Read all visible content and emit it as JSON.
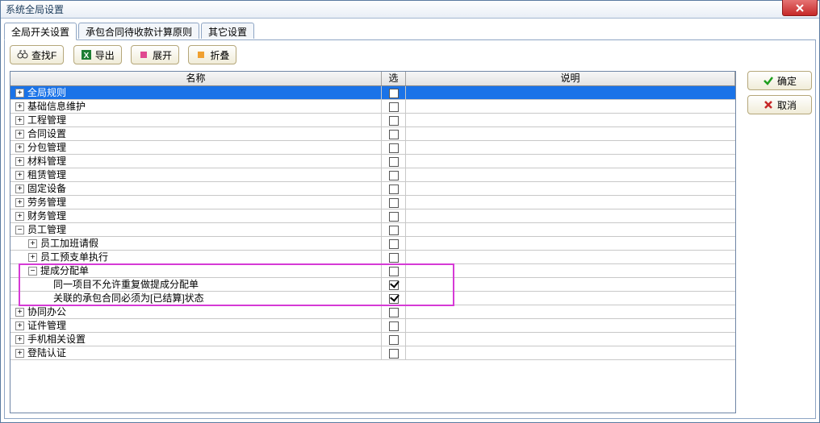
{
  "window": {
    "title": "系统全局设置"
  },
  "tabs": [
    {
      "label": "全局开关设置",
      "active": true
    },
    {
      "label": "承包合同待收款计算原则",
      "active": false
    },
    {
      "label": "其它设置",
      "active": false
    }
  ],
  "toolbar": {
    "search": "查找F",
    "export": "导出",
    "expand": "展开",
    "collapse": "折叠"
  },
  "side": {
    "ok": "确定",
    "cancel": "取消"
  },
  "grid": {
    "headers": {
      "name": "名称",
      "select": "选",
      "desc": "说明"
    },
    "rows": [
      {
        "depth": 0,
        "btn": "+",
        "label": "全局规则",
        "selected": true,
        "checked": false
      },
      {
        "depth": 0,
        "btn": "+",
        "label": "基础信息维护",
        "checked": false
      },
      {
        "depth": 0,
        "btn": "+",
        "label": "工程管理",
        "checked": false
      },
      {
        "depth": 0,
        "btn": "+",
        "label": "合同设置",
        "checked": false
      },
      {
        "depth": 0,
        "btn": "+",
        "label": "分包管理",
        "checked": false
      },
      {
        "depth": 0,
        "btn": "+",
        "label": "材料管理",
        "checked": false
      },
      {
        "depth": 0,
        "btn": "+",
        "label": "租赁管理",
        "checked": false
      },
      {
        "depth": 0,
        "btn": "+",
        "label": "固定设备",
        "checked": false
      },
      {
        "depth": 0,
        "btn": "+",
        "label": "劳务管理",
        "checked": false
      },
      {
        "depth": 0,
        "btn": "+",
        "label": "财务管理",
        "checked": false
      },
      {
        "depth": 0,
        "btn": "-",
        "label": "员工管理",
        "checked": false
      },
      {
        "depth": 1,
        "btn": "+",
        "label": "员工加班请假",
        "checked": false
      },
      {
        "depth": 1,
        "btn": "+",
        "label": "员工预支单执行",
        "checked": false
      },
      {
        "depth": 1,
        "btn": "-",
        "label": "提成分配单",
        "checked": false,
        "hl": true
      },
      {
        "depth": 2,
        "btn": "",
        "label": "同一项目不允许重复做提成分配单",
        "checked": true,
        "hl": true
      },
      {
        "depth": 2,
        "btn": "",
        "label": "关联的承包合同必须为[已结算]状态",
        "checked": true,
        "hl": true
      },
      {
        "depth": 0,
        "btn": "+",
        "label": "协同办公",
        "checked": false
      },
      {
        "depth": 0,
        "btn": "+",
        "label": "证件管理",
        "checked": false
      },
      {
        "depth": 0,
        "btn": "+",
        "label": "手机相关设置",
        "checked": false
      },
      {
        "depth": 0,
        "btn": "+",
        "label": "登陆认证",
        "checked": false
      }
    ]
  }
}
